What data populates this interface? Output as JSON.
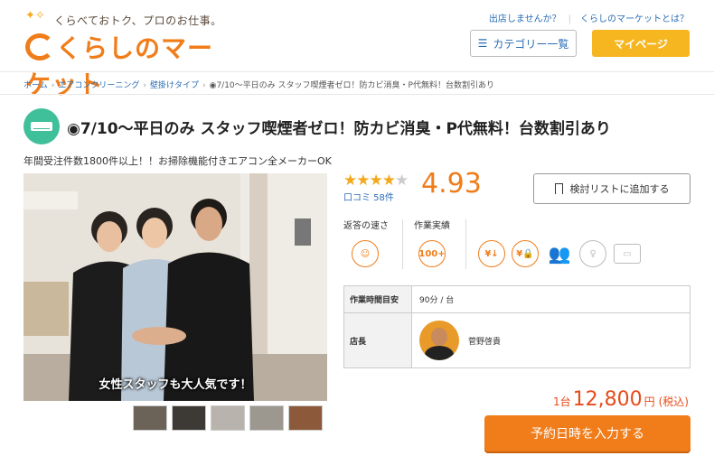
{
  "header": {
    "tagline": "くらべておトク、プロのお仕事。",
    "logo_text": "くらしのマーケット",
    "links": [
      "出店しませんか？",
      "くらしのマーケットとは？"
    ],
    "category_button": "カテゴリー一覧",
    "mypage_button": "マイページ"
  },
  "breadcrumb": {
    "items": [
      "ホーム",
      "エアコンクリーニング",
      "壁掛けタイプ"
    ],
    "current": "◉7/10～平日のみ スタッフ喫煙者ゼロ！防カビ消臭・P代無料！台数割引あり"
  },
  "listing": {
    "title": "◉7/10～平日のみ スタッフ喫煙者ゼロ！防カビ消臭・P代無料！台数割引あり",
    "subtitle": "年間受注件数1800件以上！！お掃除機能付きエアコン全メーカーOK",
    "photo_caption": "女性スタッフも大人気です！",
    "thumbnail_count": 5
  },
  "rating": {
    "stars_filled": 4,
    "stars_total": 5,
    "stars_on": "★★★★",
    "stars_off": "★",
    "reviews_label": "口コミ 58件",
    "score": "4.93"
  },
  "favorite_button": "検討リストに追加する",
  "badges": {
    "response_label": "返答の速さ",
    "record_label": "作業実績",
    "record_value": "100+"
  },
  "details": {
    "rows": [
      {
        "label": "作業時間目安",
        "value": "90分 / 台"
      },
      {
        "label": "店長",
        "value": "菅野啓貴"
      }
    ]
  },
  "price": {
    "unit": "1台",
    "amount": "12,800",
    "currency": "円",
    "tax": "(税込)"
  },
  "book_button": "予約日時を入力する",
  "colors": {
    "brand_orange": "#f07d1a",
    "mypage_yellow": "#f6b620",
    "star": "#f4a81d",
    "link_blue": "#2a6db5",
    "category_teal": "#3fbf9a"
  }
}
